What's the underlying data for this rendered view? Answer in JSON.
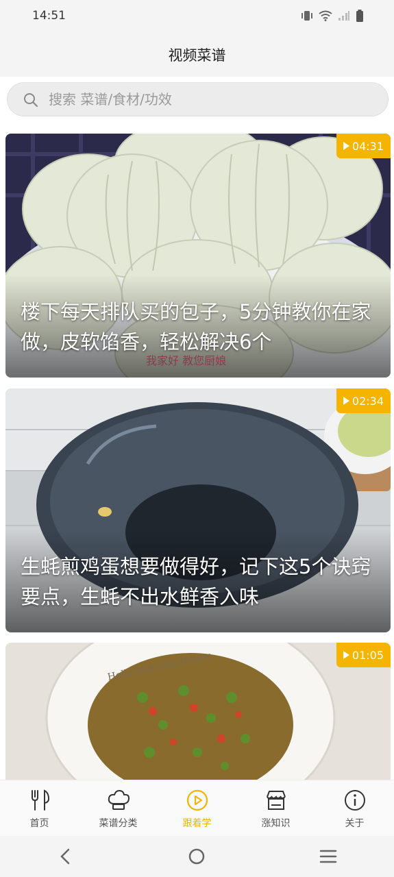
{
  "status": {
    "time": "14:51"
  },
  "header": {
    "title": "视频菜谱"
  },
  "search": {
    "placeholder": "搜索 菜谱/食材/功效"
  },
  "videos": [
    {
      "title": "楼下每天排队买的包子，5分钟教你在家做，皮软馅香，轻松解决6个",
      "duration": "04:31",
      "watermark": "我家好 教您厨娘"
    },
    {
      "title": "生蚝煎鸡蛋想要做得好，记下这5个诀窍要点，生蚝不出水鲜香入味",
      "duration": "02:34"
    },
    {
      "title": "",
      "duration": "01:05",
      "plate_text": "Hello Morning Honey"
    }
  ],
  "tabs": [
    {
      "label": "首页",
      "icon": "fork-knife-icon"
    },
    {
      "label": "菜谱分类",
      "icon": "chef-hat-icon"
    },
    {
      "label": "跟着学",
      "icon": "play-circle-icon"
    },
    {
      "label": "涨知识",
      "icon": "shop-icon"
    },
    {
      "label": "关于",
      "icon": "info-icon"
    }
  ],
  "colors": {
    "accent": "#f5b400",
    "background": "#f4f4f4"
  }
}
